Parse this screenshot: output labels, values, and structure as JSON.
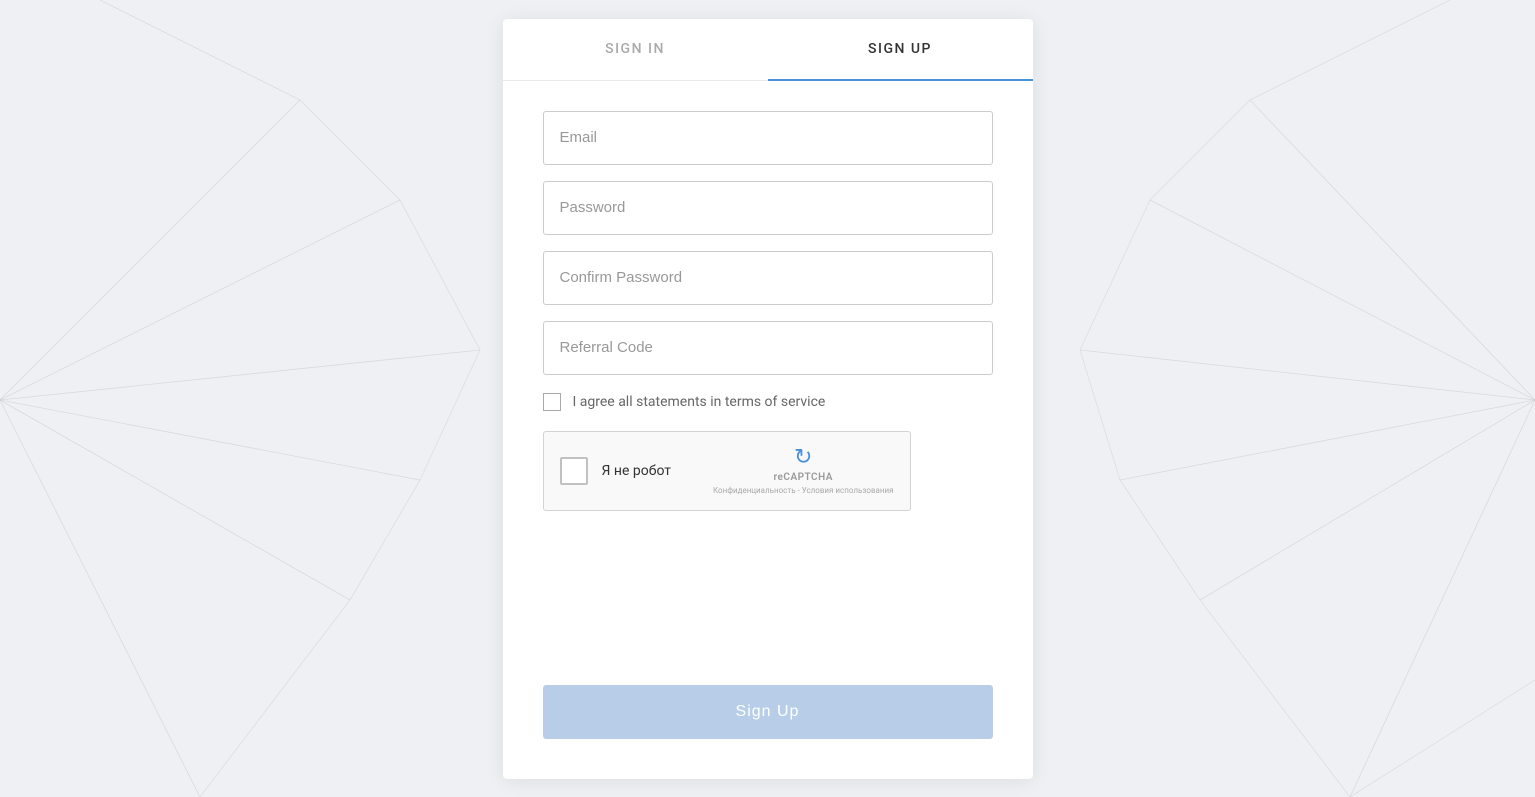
{
  "background": {
    "color": "#f0f2f5"
  },
  "tabs": {
    "signin": {
      "label": "SIGN IN",
      "active": false
    },
    "signup": {
      "label": "SIGN UP",
      "active": true
    }
  },
  "form": {
    "email_placeholder": "Email",
    "password_placeholder": "Password",
    "confirm_password_placeholder": "Confirm Password",
    "referral_code_placeholder": "Referral Code",
    "terms_label": "I agree all statements in terms of service",
    "recaptcha_label": "Я не робот",
    "recaptcha_brand": "reCAPTCHA",
    "recaptcha_links": "Конфиденциальность - Условия использования",
    "signup_button_label": "Sign Up"
  },
  "accent_color": "#4a90d9",
  "button_color": "#b8cee8"
}
